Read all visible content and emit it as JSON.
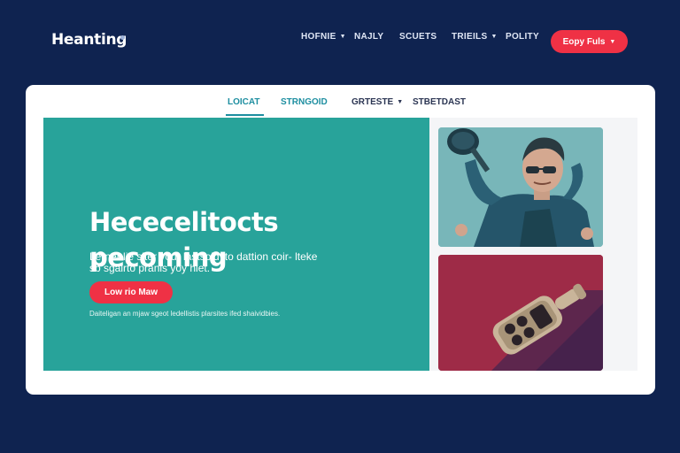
{
  "header": {
    "logo": "Heanting",
    "nav": [
      {
        "label": "HOFNIE",
        "dropdown": true
      },
      {
        "label": "NAJLY",
        "dropdown": false
      },
      {
        "label": "SCUETS",
        "dropdown": false
      },
      {
        "label": "TRIEILS",
        "dropdown": true
      },
      {
        "label": "POLITY",
        "dropdown": false
      }
    ],
    "cta_label": "Eopy Fuls"
  },
  "tabs": [
    {
      "label": "LOICAT",
      "active": true
    },
    {
      "label": "STRNGOID",
      "active": false
    },
    {
      "label": "GRTESTE",
      "dropdown": true
    },
    {
      "label": "STBETDAST",
      "active": false
    }
  ],
  "hero": {
    "title_line1": "Hececelitocts",
    "title_line2": "pecoming",
    "subtitle": "Lerner lie siter your lastsoid ito dattion coir- lteke sb sgairto pranis yoy hiet.",
    "button_label": "Low rio Maw",
    "note": "Daiteligan an mjaw sgeot ledellistis plarsites ifed shaividbies."
  },
  "images": [
    {
      "icon": "person-with-pan-photo"
    },
    {
      "icon": "handheld-device-photo"
    }
  ],
  "colors": {
    "page_bg": "#0f2350",
    "accent_red": "#ef3145",
    "teal": "#28a39a",
    "tab_active": "#1d8ea0",
    "maroon": "#9e2b47"
  }
}
